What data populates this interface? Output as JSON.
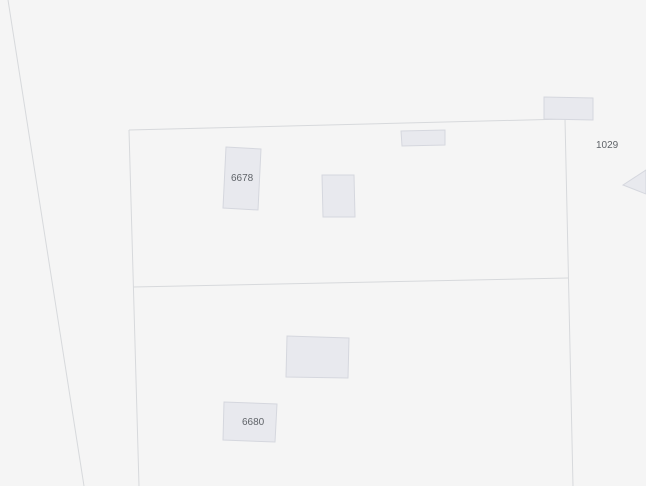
{
  "map": {
    "colors": {
      "background": "#f5f5f5",
      "parcel_line": "#d7d9dc",
      "building_fill": "#e8e9ee",
      "building_stroke": "#d5d7de",
      "label_text": "#5f6368"
    },
    "labels": {
      "building_6678": "6678",
      "building_6680": "6680",
      "address_1029": "1029"
    }
  }
}
